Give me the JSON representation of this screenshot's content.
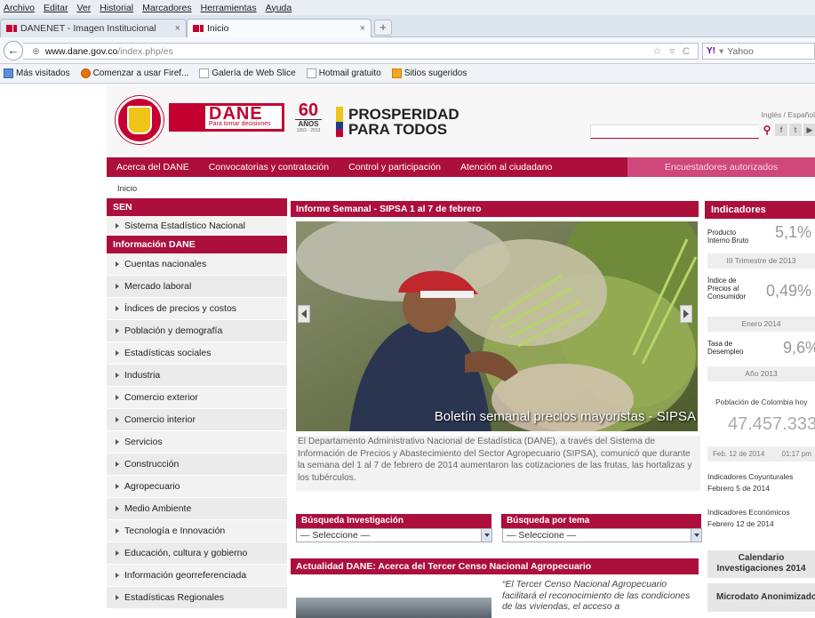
{
  "browser": {
    "menu": [
      "Archivo",
      "Editar",
      "Ver",
      "Historial",
      "Marcadores",
      "Herramientas",
      "Ayuda"
    ],
    "tabs": [
      {
        "label": "DANENET - Imagen Institucional"
      },
      {
        "label": "Inicio"
      }
    ],
    "url_host": "www.dane.gov.co",
    "url_path": "/index.php/es",
    "search_engine": "Yahoo",
    "bookmarks": [
      "Más visitados",
      "Comenzar a usar Firef...",
      "Galería de Web Slice",
      "Hotmail gratuito",
      "Sitios sugeridos"
    ]
  },
  "header": {
    "logo_name": "DANE",
    "logo_tagline": "Para tomar decisiones",
    "anniversary_number": "60",
    "anniversary_word": "AÑOS",
    "anniversary_years": "1953 - 2013",
    "prosperidad": "PROSPERIDAD PARA TODOS",
    "lang": "Inglés / Español",
    "brand_color": "#ad0f3d"
  },
  "mainnav": {
    "items": [
      "Acerca del DANE",
      "Convocatorias y contratación",
      "Control y participación",
      "Atención al ciudadano"
    ],
    "highlight": "Encuestadores autorizados"
  },
  "breadcrumb": "Inicio",
  "leftnav": {
    "sen_title": "SEN",
    "sen_items": [
      "Sistema Estadístico Nacional"
    ],
    "info_title": "Información DANE",
    "info_items": [
      "Cuentas nacionales",
      "Mercado laboral",
      "Índices de precios y costos",
      "Población y demografía",
      "Estadísticas sociales",
      "Industria",
      "Comercio exterior",
      "Comercio interior",
      "Servicios",
      "Construcción",
      "Agropecuario",
      "Medio Ambiente",
      "Tecnología e Innovación",
      "Educación, cultura y gobierno",
      "Información georreferenciada",
      "Estadísticas Regionales"
    ]
  },
  "informe": {
    "title": "Informe Semanal - SIPSA 1 al 7 de febrero",
    "slide_caption": "Boletín semanal precios mayoristas - SIPSA",
    "text": "El Departamento Administrativo Nacional de Estadística (DANE), a través del Sistema de Información de Precios y Abastecimiento del Sector Agropecuario (SIPSA), comunicó que durante la semana del 1 al 7 de febrero de 2014 aumentaron las cotizaciones de las frutas, las hortalizas y los tubérculos."
  },
  "busqueda": {
    "investigacion_title": "Búsqueda Investigación",
    "tema_title": "Búsqueda por tema",
    "select_placeholder": "— Seleccione —"
  },
  "actualidad": {
    "title": "Actualidad DANE: Acerca del Tercer Censo Nacional Agropecuario",
    "quote": "“El Tercer Censo Nacional Agropecuario facilitará el reconocimiento de las condiciones de las viviendas, el acceso a"
  },
  "indicadores": {
    "title": "Indicadores",
    "items": [
      {
        "label": "Producto Interno Bruto",
        "value": "5,1%",
        "period": "III Trimestre de 2013"
      },
      {
        "label": "Índice de Precios al Consumidor",
        "value": "0,49%",
        "period": "Enero 2014"
      },
      {
        "label": "Tasa de Desempleo",
        "value": "9,6%",
        "period": "Año 2013"
      }
    ],
    "poblacion_label": "Población de Colombia hoy",
    "poblacion_value": "47.457.333",
    "poblacion_date": "Feb. 12 de 2014",
    "poblacion_time": "01:17 pm",
    "coyunturales": "Indicadores Coyunturales",
    "coyunturales_date": "Febrero 5 de 2014",
    "economicos": "Indicadores Económicos",
    "economicos_date": "Febrero 12 de 2014",
    "calendario": "Calendario Investigaciones 2014",
    "microdato": "Microdato Anonimizado"
  }
}
